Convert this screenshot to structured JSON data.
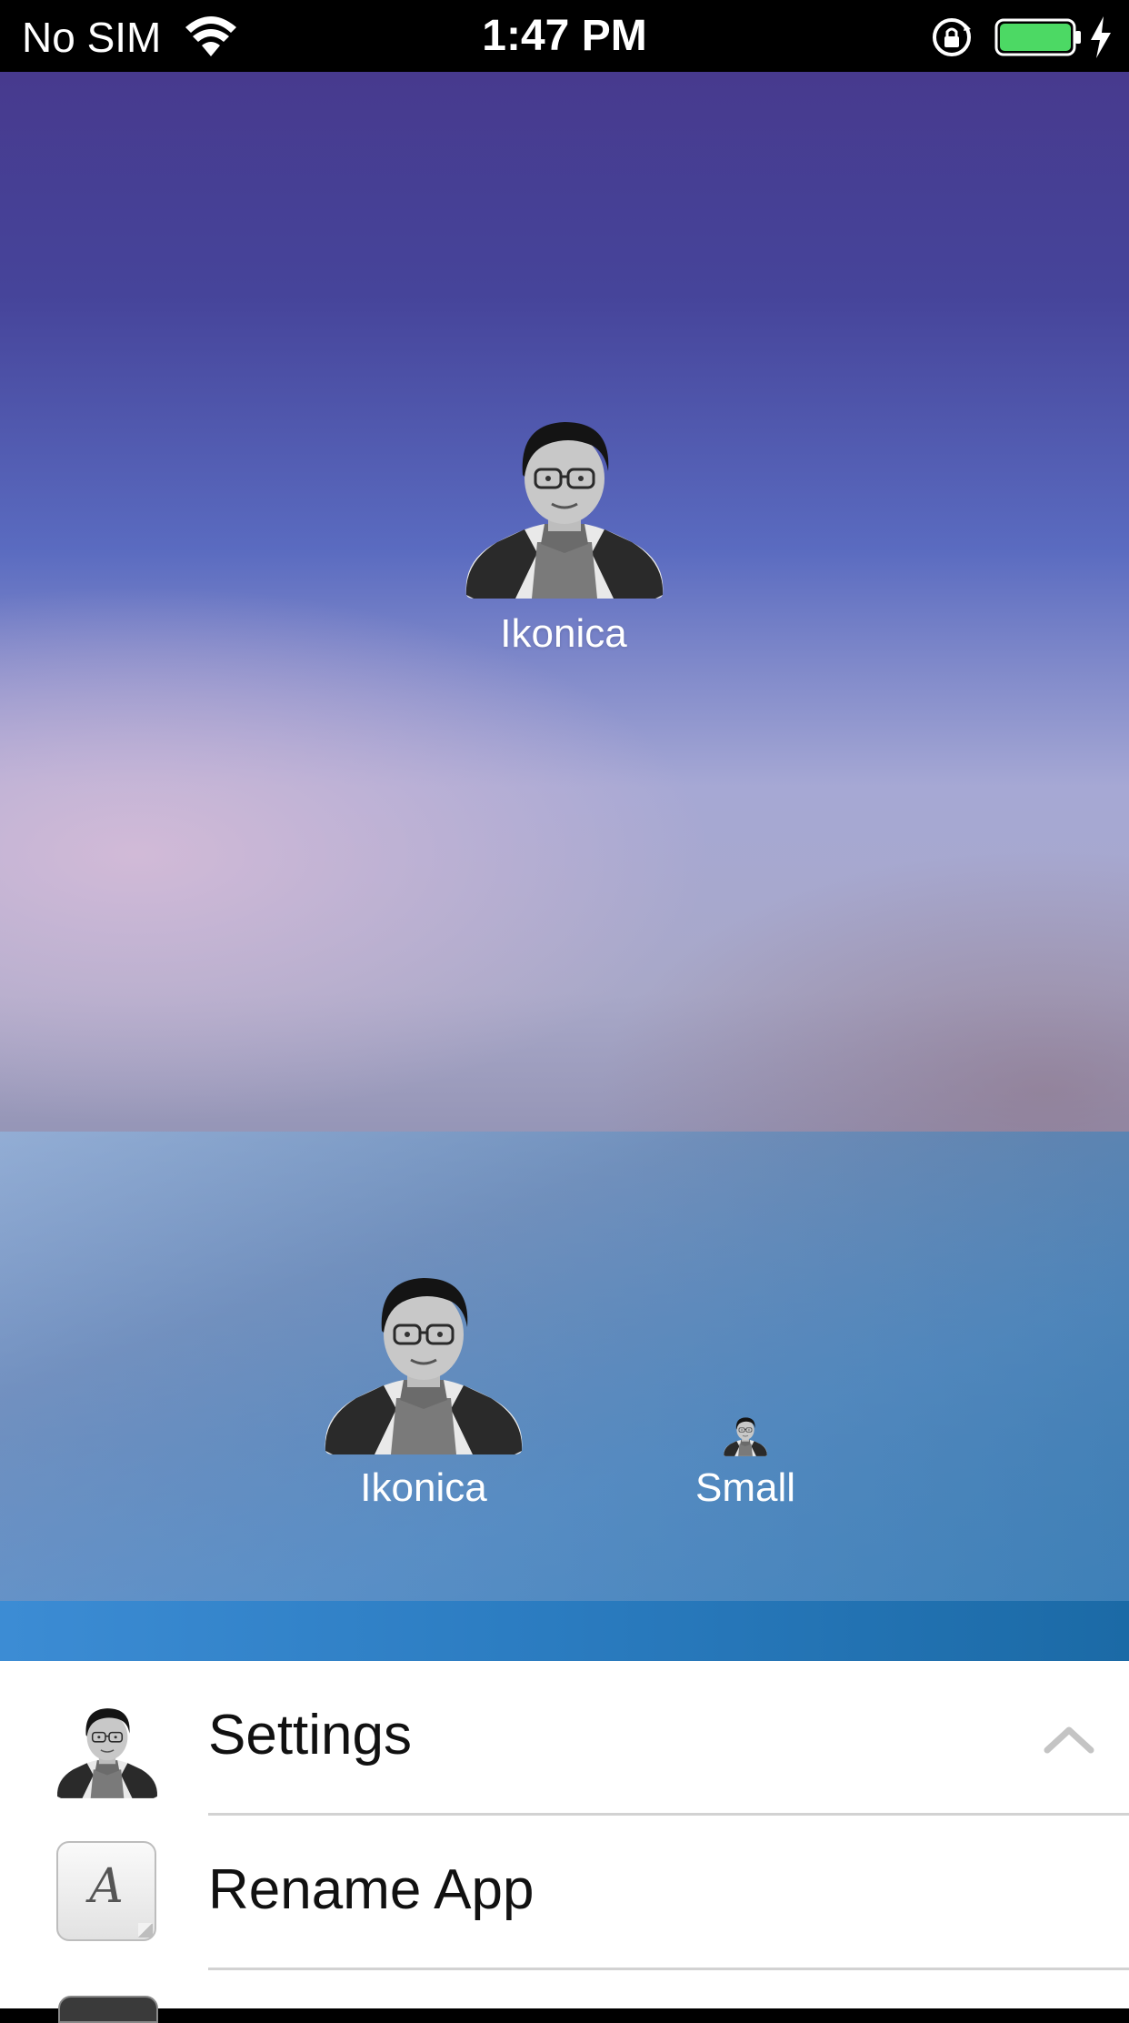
{
  "status_bar": {
    "carrier": "No SIM",
    "time": "1:47 PM",
    "battery_level": 1.0,
    "battery_color": "#4cd964",
    "icons": [
      "wifi-icon",
      "rotation-lock-icon",
      "battery-icon",
      "charging-bolt-icon"
    ]
  },
  "home": {
    "apps": [
      {
        "label": "Ikonica",
        "icon": "portrait-avatar-icon"
      }
    ]
  },
  "dock": {
    "apps": [
      {
        "label": "Ikonica",
        "icon": "portrait-avatar-icon"
      },
      {
        "label": "Small",
        "icon": "small-portrait-avatar-icon"
      }
    ]
  },
  "settings_sheet": {
    "header_label": "Settings",
    "header_icon": "portrait-avatar-icon",
    "chevron_icon": "chevron-up-icon",
    "rows": [
      {
        "label": "Rename App",
        "icon": "rename-font-icon",
        "glyph": "A"
      }
    ]
  },
  "colors": {
    "wallpaper_top": "#473a8e",
    "dock_tint": "#4a8ac4",
    "sheet_background": "#ffffff"
  }
}
